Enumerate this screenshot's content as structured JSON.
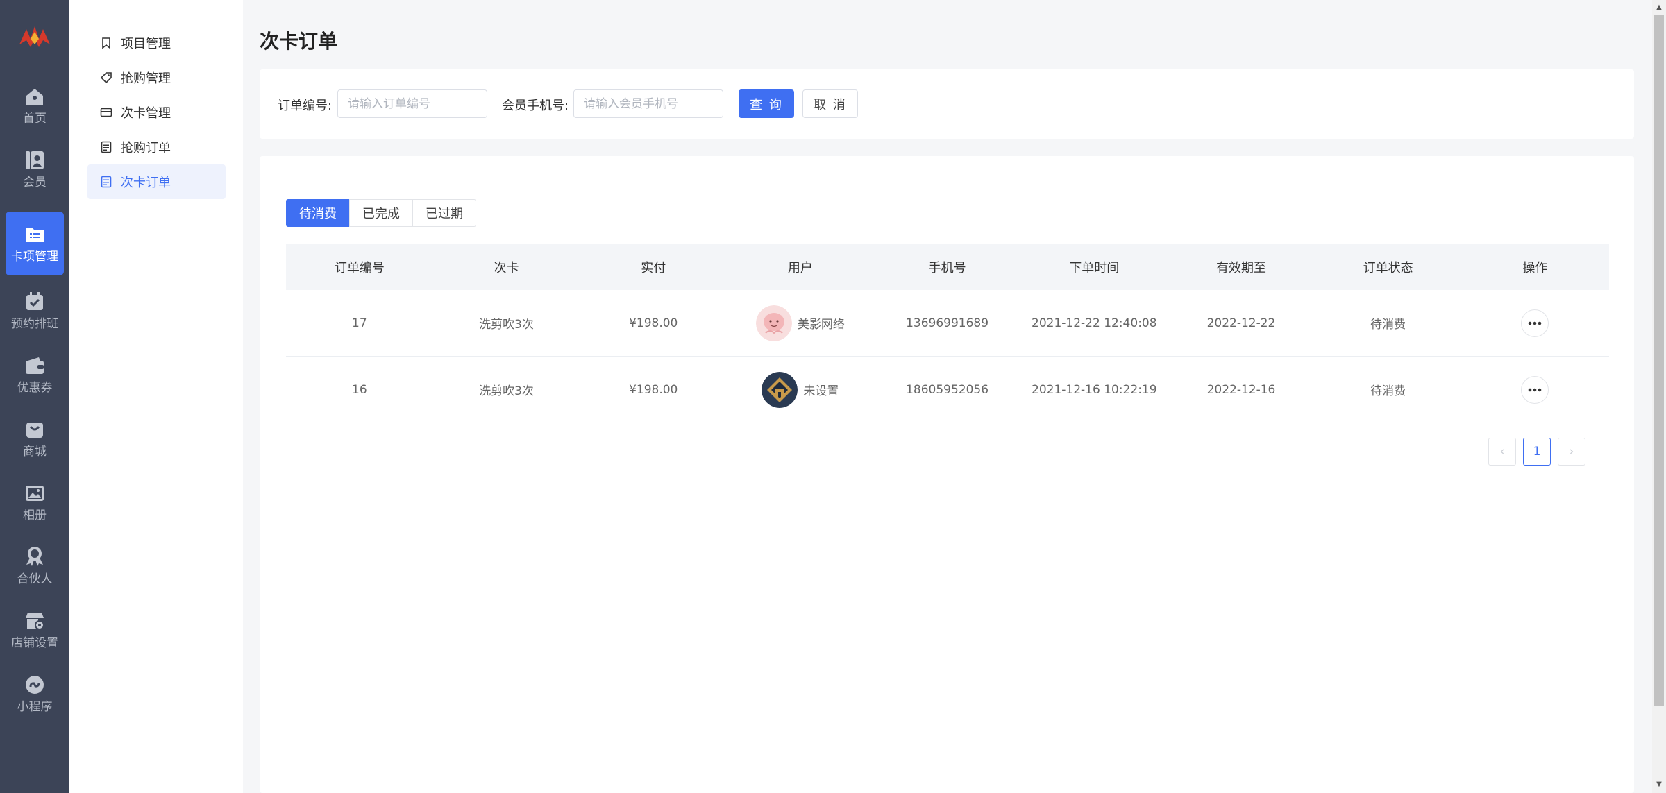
{
  "rail": {
    "items": [
      {
        "label": "首页",
        "icon": "home-icon"
      },
      {
        "label": "会员",
        "icon": "member-icon"
      },
      {
        "label": "卡项管理",
        "icon": "folder-list-icon"
      },
      {
        "label": "预约排班",
        "icon": "calendar-check-icon"
      },
      {
        "label": "优惠券",
        "icon": "wallet-icon"
      },
      {
        "label": "商城",
        "icon": "shopping-bag-icon"
      },
      {
        "label": "相册",
        "icon": "album-icon"
      },
      {
        "label": "合伙人",
        "icon": "partner-icon"
      },
      {
        "label": "店铺设置",
        "icon": "store-settings-icon"
      },
      {
        "label": "小程序",
        "icon": "mini-program-icon"
      }
    ],
    "active_index": 2
  },
  "submenu": {
    "items": [
      {
        "label": "项目管理",
        "icon": "bookmark-icon"
      },
      {
        "label": "抢购管理",
        "icon": "tag-icon"
      },
      {
        "label": "次卡管理",
        "icon": "card-icon"
      },
      {
        "label": "抢购订单",
        "icon": "document-icon"
      },
      {
        "label": "次卡订单",
        "icon": "document-icon"
      }
    ],
    "active_index": 4
  },
  "page": {
    "title": "次卡订单"
  },
  "filter": {
    "order_no_label": "订单编号:",
    "order_no_placeholder": "请输入订单编号",
    "order_no_value": "",
    "phone_label": "会员手机号:",
    "phone_placeholder": "请输入会员手机号",
    "phone_value": "",
    "query_button": "查 询",
    "cancel_button": "取 消"
  },
  "tabs": {
    "items": [
      "待消费",
      "已完成",
      "已过期"
    ],
    "active_index": 0
  },
  "table": {
    "columns": [
      "订单编号",
      "次卡",
      "实付",
      "用户",
      "手机号",
      "下单时间",
      "有效期至",
      "订单状态",
      "操作"
    ],
    "rows": [
      {
        "order_no": "17",
        "card": "洗剪吹3次",
        "paid": "¥198.00",
        "user": "美影网络",
        "avatar": "pink-cartoon-avatar",
        "phone": "13696991689",
        "order_time": "2021-12-22 12:40:08",
        "valid_until": "2022-12-22",
        "status": "待消费"
      },
      {
        "order_no": "16",
        "card": "洗剪吹3次",
        "paid": "¥198.00",
        "user": "未设置",
        "avatar": "dark-house-avatar",
        "phone": "18605952056",
        "order_time": "2021-12-16 10:22:19",
        "valid_until": "2022-12-16",
        "status": "待消费"
      }
    ]
  },
  "pagination": {
    "prev": "‹",
    "current": "1",
    "next": "›"
  },
  "colors": {
    "primary": "#3f6ff2",
    "rail_bg": "#3c4457",
    "page_bg": "#f5f6f8"
  }
}
